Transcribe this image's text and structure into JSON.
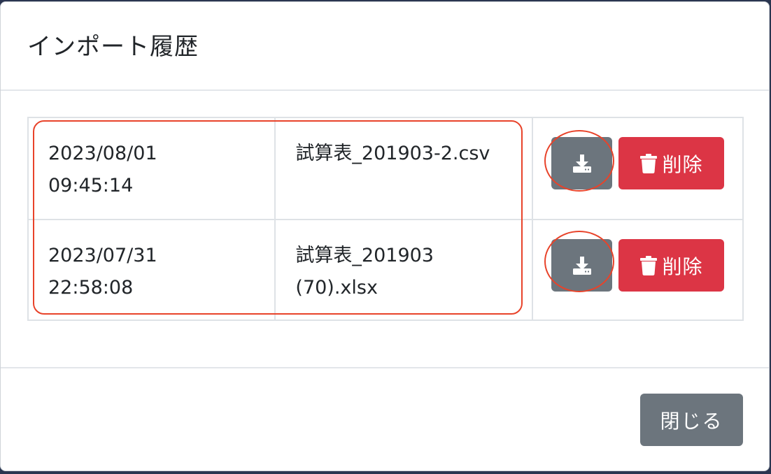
{
  "modal": {
    "title": "インポート履歴",
    "close_label": "閉じる"
  },
  "history": [
    {
      "date": "2023/08/01",
      "time": "09:45:14",
      "filename": "試算表_201903-2.csv",
      "download_icon": "download-icon",
      "delete_label": "削除",
      "delete_icon": "trash-icon"
    },
    {
      "date": "2023/07/31",
      "time": "22:58:08",
      "filename": "試算表_201903 (70).xlsx",
      "download_icon": "download-icon",
      "delete_label": "削除",
      "delete_icon": "trash-icon"
    }
  ],
  "colors": {
    "secondary": "#6c757d",
    "danger": "#dc3545",
    "annotation": "#e8432a",
    "border": "#dee2e6"
  }
}
